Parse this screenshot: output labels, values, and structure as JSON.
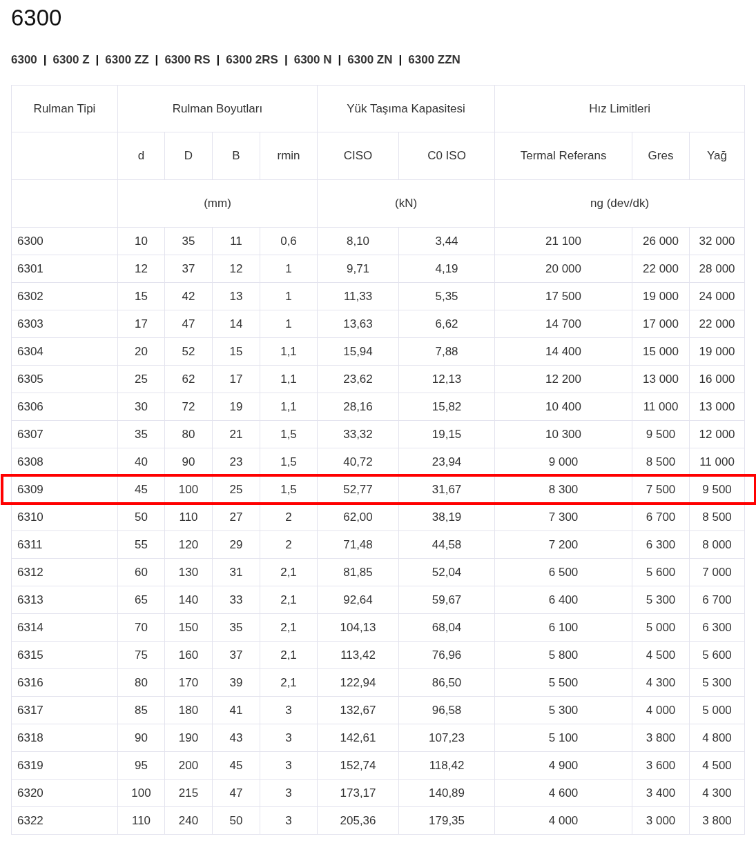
{
  "title": "6300",
  "variants": [
    {
      "kind": "link",
      "text": "6300"
    },
    {
      "kind": "separator",
      "text": "|"
    },
    {
      "kind": "link",
      "text": "6300 Z"
    },
    {
      "kind": "separator",
      "text": "|"
    },
    {
      "kind": "link",
      "text": "6300 ZZ"
    },
    {
      "kind": "separator",
      "text": "|"
    },
    {
      "kind": "link",
      "text": "6300 RS"
    },
    {
      "kind": "separator",
      "text": "|"
    },
    {
      "kind": "link",
      "text": "6300 2RS"
    },
    {
      "kind": "separator",
      "text": "|"
    },
    {
      "kind": "link",
      "text": "6300 N"
    },
    {
      "kind": "separator",
      "text": "|"
    },
    {
      "kind": "link",
      "text": "6300 ZN"
    },
    {
      "kind": "separator",
      "text": "|"
    },
    {
      "kind": "link",
      "text": "6300 ZZN"
    }
  ],
  "table": {
    "group_headers": [
      "Rulman Tipi",
      "Rulman Boyutları",
      "Yük Taşıma Kapasitesi",
      "Hız Limitleri"
    ],
    "columns": [
      "",
      "d",
      "D",
      "B",
      "rmin",
      "CISO",
      "C0 ISO",
      "Termal Referans",
      "Gres",
      "Yağ"
    ],
    "units": [
      "(mm)",
      "(kN)",
      "ng (dev/dk)"
    ],
    "rows": [
      {
        "cells": [
          "6300",
          "10",
          "35",
          "11",
          "0,6",
          "8,10",
          "3,44",
          "21 100",
          "26 000",
          "32 000"
        ],
        "highlighted": false
      },
      {
        "cells": [
          "6301",
          "12",
          "37",
          "12",
          "1",
          "9,71",
          "4,19",
          "20 000",
          "22 000",
          "28 000"
        ],
        "highlighted": false
      },
      {
        "cells": [
          "6302",
          "15",
          "42",
          "13",
          "1",
          "11,33",
          "5,35",
          "17 500",
          "19 000",
          "24 000"
        ],
        "highlighted": false
      },
      {
        "cells": [
          "6303",
          "17",
          "47",
          "14",
          "1",
          "13,63",
          "6,62",
          "14 700",
          "17 000",
          "22 000"
        ],
        "highlighted": false
      },
      {
        "cells": [
          "6304",
          "20",
          "52",
          "15",
          "1,1",
          "15,94",
          "7,88",
          "14 400",
          "15 000",
          "19 000"
        ],
        "highlighted": false
      },
      {
        "cells": [
          "6305",
          "25",
          "62",
          "17",
          "1,1",
          "23,62",
          "12,13",
          "12 200",
          "13 000",
          "16 000"
        ],
        "highlighted": false
      },
      {
        "cells": [
          "6306",
          "30",
          "72",
          "19",
          "1,1",
          "28,16",
          "15,82",
          "10 400",
          "11 000",
          "13 000"
        ],
        "highlighted": false
      },
      {
        "cells": [
          "6307",
          "35",
          "80",
          "21",
          "1,5",
          "33,32",
          "19,15",
          "10 300",
          "9 500",
          "12 000"
        ],
        "highlighted": false
      },
      {
        "cells": [
          "6308",
          "40",
          "90",
          "23",
          "1,5",
          "40,72",
          "23,94",
          "9 000",
          "8 500",
          "11 000"
        ],
        "highlighted": false
      },
      {
        "cells": [
          "6309",
          "45",
          "100",
          "25",
          "1,5",
          "52,77",
          "31,67",
          "8 300",
          "7 500",
          "9 500"
        ],
        "highlighted": true
      },
      {
        "cells": [
          "6310",
          "50",
          "110",
          "27",
          "2",
          "62,00",
          "38,19",
          "7 300",
          "6 700",
          "8 500"
        ],
        "highlighted": false
      },
      {
        "cells": [
          "6311",
          "55",
          "120",
          "29",
          "2",
          "71,48",
          "44,58",
          "7 200",
          "6 300",
          "8 000"
        ],
        "highlighted": false
      },
      {
        "cells": [
          "6312",
          "60",
          "130",
          "31",
          "2,1",
          "81,85",
          "52,04",
          "6 500",
          "5 600",
          "7 000"
        ],
        "highlighted": false
      },
      {
        "cells": [
          "6313",
          "65",
          "140",
          "33",
          "2,1",
          "92,64",
          "59,67",
          "6 400",
          "5 300",
          "6 700"
        ],
        "highlighted": false
      },
      {
        "cells": [
          "6314",
          "70",
          "150",
          "35",
          "2,1",
          "104,13",
          "68,04",
          "6 100",
          "5 000",
          "6 300"
        ],
        "highlighted": false
      },
      {
        "cells": [
          "6315",
          "75",
          "160",
          "37",
          "2,1",
          "113,42",
          "76,96",
          "5 800",
          "4 500",
          "5 600"
        ],
        "highlighted": false
      },
      {
        "cells": [
          "6316",
          "80",
          "170",
          "39",
          "2,1",
          "122,94",
          "86,50",
          "5 500",
          "4 300",
          "5 300"
        ],
        "highlighted": false
      },
      {
        "cells": [
          "6317",
          "85",
          "180",
          "41",
          "3",
          "132,67",
          "96,58",
          "5 300",
          "4 000",
          "5 000"
        ],
        "highlighted": false
      },
      {
        "cells": [
          "6318",
          "90",
          "190",
          "43",
          "3",
          "142,61",
          "107,23",
          "5 100",
          "3 800",
          "4 800"
        ],
        "highlighted": false
      },
      {
        "cells": [
          "6319",
          "95",
          "200",
          "45",
          "3",
          "152,74",
          "118,42",
          "4 900",
          "3 600",
          "4 500"
        ],
        "highlighted": false
      },
      {
        "cells": [
          "6320",
          "100",
          "215",
          "47",
          "3",
          "173,17",
          "140,89",
          "4 600",
          "3 400",
          "4 300"
        ],
        "highlighted": false
      },
      {
        "cells": [
          "6322",
          "110",
          "240",
          "50",
          "3",
          "205,36",
          "179,35",
          "4 000",
          "3 000",
          "3 800"
        ],
        "highlighted": false
      }
    ]
  }
}
